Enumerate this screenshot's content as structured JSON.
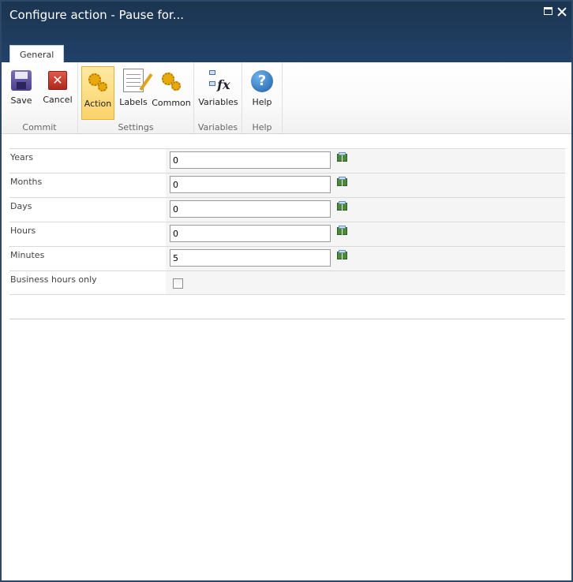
{
  "window": {
    "title": "Configure action - Pause for...",
    "tab": "General"
  },
  "ribbon": {
    "commit": {
      "label": "Commit",
      "save": "Save",
      "cancel": "Cancel"
    },
    "settings": {
      "label": "Settings",
      "action": "Action",
      "labels": "Labels",
      "common": "Common"
    },
    "variables": {
      "label": "Variables",
      "variables": "Variables"
    },
    "help": {
      "label": "Help",
      "help": "Help"
    }
  },
  "form": {
    "rows": [
      {
        "label": "Years",
        "value": "0"
      },
      {
        "label": "Months",
        "value": "0"
      },
      {
        "label": "Days",
        "value": "0"
      },
      {
        "label": "Hours",
        "value": "0"
      },
      {
        "label": "Minutes",
        "value": "5"
      }
    ],
    "business_hours": {
      "label": "Business hours only",
      "checked": false
    }
  },
  "colors": {
    "titlebar": "#1e3a59",
    "active_button": "#fbd36a"
  }
}
